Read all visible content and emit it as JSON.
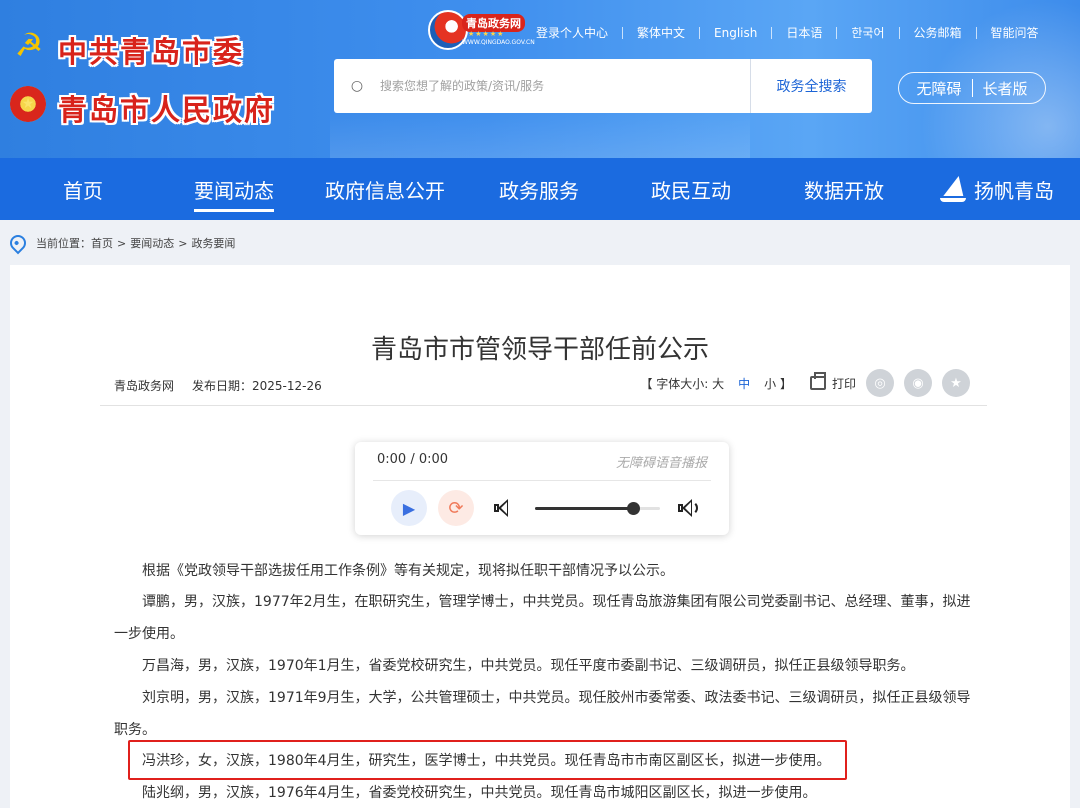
{
  "header": {
    "org_party": "中共青岛市委",
    "org_gov": "青岛市人民政府",
    "logo_name": "青岛政务网",
    "logo_url": "WWW.QINGDAO.GOV.CN",
    "top_links": [
      "登录个人中心",
      "繁体中文",
      "English",
      "日本语",
      "한국어",
      "公务邮箱",
      "智能问答"
    ],
    "search_placeholder": "搜索您想了解的政策/资讯/服务",
    "search_button": "政务全搜索",
    "accessibility": "无障碍",
    "elder_mode": "长者版"
  },
  "nav": {
    "items": [
      "首页",
      "要闻动态",
      "政府信息公开",
      "政务服务",
      "政民互动",
      "数据开放",
      "扬帆青岛"
    ],
    "active_index": 1
  },
  "breadcrumb": {
    "label": "当前位置：",
    "items": [
      "首页",
      "要闻动态",
      "政务要闻"
    ],
    "separator": ">"
  },
  "article": {
    "title": "青岛市市管领导干部任前公示",
    "source": "青岛政务网",
    "date_label": "发布日期：2025-12-26",
    "font_size_label": "【 字体大小: 大",
    "font_mid": "中",
    "font_small": "小 】",
    "print": "打印",
    "share_icons": [
      "wechat-icon",
      "weibo-icon",
      "favorite-icon"
    ],
    "paragraphs": [
      "根据《党政领导干部选拔任用工作条例》等有关规定，现将拟任职干部情况予以公示。",
      "谭鹏，男，汉族，1977年2月生，在职研究生，管理学博士，中共党员。现任青岛旅游集团有限公司党委副书记、总经理、董事，拟进一步使用。",
      "万昌海，男，汉族，1970年1月生，省委党校研究生，中共党员。现任平度市委副书记、三级调研员，拟任正县级领导职务。",
      "刘京明，男，汉族，1971年9月生，大学，公共管理硕士，中共党员。现任胶州市委常委、政法委书记、三级调研员，拟任正县级领导职务。",
      "冯洪珍，女，汉族，1980年4月生，研究生，医学博士，中共党员。现任青岛市市南区副区长，拟进一步使用。",
      "陆兆纲，男，汉族，1976年4月生，省委党校研究生，中共党员。现任青岛市城阳区副区长，拟进一步使用。"
    ]
  },
  "player": {
    "time": "0:00 / 0:00",
    "label": "无障碍语音播报",
    "volume": 0.78
  },
  "colors": {
    "nav_bg": "#1b6be0",
    "accent": "#1c64d6",
    "highlight_border": "#e0201c",
    "title_red": "#d8231b"
  }
}
